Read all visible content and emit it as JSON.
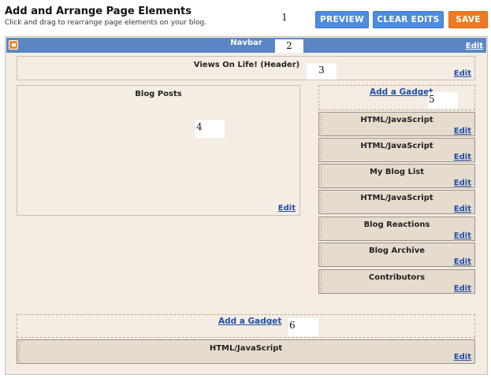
{
  "header": {
    "title": "Add and Arrange Page Elements",
    "subtitle": "Click and drag to rearrange page elements on your blog."
  },
  "toolbar": {
    "preview_label": "PREVIEW",
    "clear_edits_label": "CLEAR EDITS",
    "save_label": "SAVE"
  },
  "markers": [
    "1",
    "2",
    "3",
    "4",
    "5",
    "6"
  ],
  "navbar": {
    "label": "Navbar",
    "edit_label": "Edit"
  },
  "header_section": {
    "title": "Views On Life! (Header)",
    "edit_label": "Edit"
  },
  "blog_posts": {
    "title": "Blog Posts",
    "edit_label": "Edit"
  },
  "sidebar": {
    "add_gadget_label": "Add a Gadget",
    "gadgets": [
      {
        "title": "HTML/JavaScript",
        "edit_label": "Edit"
      },
      {
        "title": "HTML/JavaScript",
        "edit_label": "Edit"
      },
      {
        "title": "My Blog List",
        "edit_label": "Edit"
      },
      {
        "title": "HTML/JavaScript",
        "edit_label": "Edit"
      },
      {
        "title": "Blog Reactions",
        "edit_label": "Edit"
      },
      {
        "title": "Blog Archive",
        "edit_label": "Edit"
      },
      {
        "title": "Contributors",
        "edit_label": "Edit"
      }
    ]
  },
  "footer": {
    "add_gadget_label": "Add a Gadget",
    "gadgets": [
      {
        "title": "HTML/JavaScript",
        "edit_label": "Edit"
      }
    ]
  },
  "colors": {
    "button_blue": "#4d8ce0",
    "button_orange": "#f07a21",
    "navbar_blue": "#5b86c5",
    "canvas_bg": "#f4ece3",
    "gadget_bg": "#e6dccd",
    "link_blue": "#1f4fa8"
  }
}
